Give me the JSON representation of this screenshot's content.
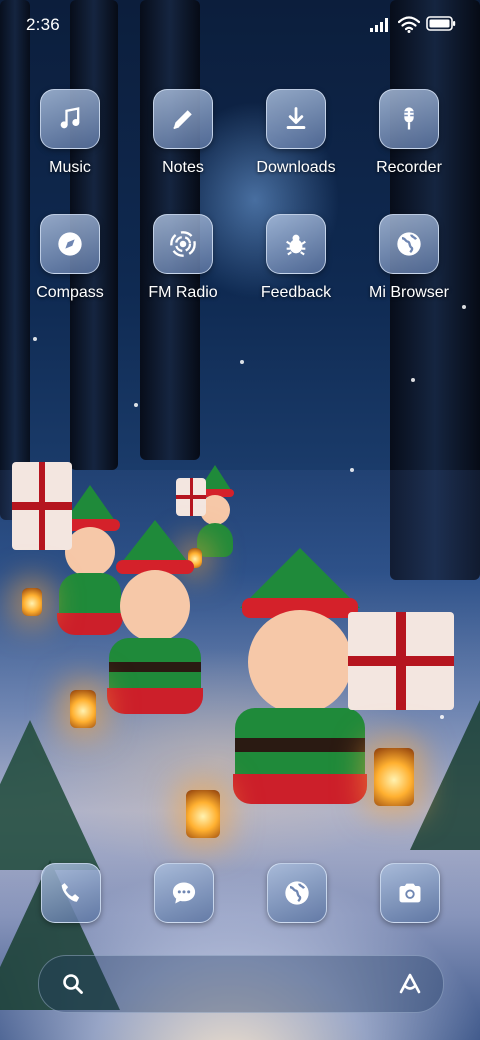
{
  "status_bar": {
    "time": "2:36",
    "signal_icon": "cellular-signal-icon",
    "wifi_icon": "wifi-icon",
    "battery_icon": "battery-full-icon"
  },
  "apps": [
    {
      "label": "Music",
      "icon": "music-note-icon"
    },
    {
      "label": "Notes",
      "icon": "pencil-icon"
    },
    {
      "label": "Downloads",
      "icon": "download-icon"
    },
    {
      "label": "Recorder",
      "icon": "microphone-icon"
    },
    {
      "label": "Compass",
      "icon": "compass-icon"
    },
    {
      "label": "FM Radio",
      "icon": "radio-waves-icon"
    },
    {
      "label": "Feedback",
      "icon": "bug-icon"
    },
    {
      "label": "Mi Browser",
      "icon": "globe-icon"
    }
  ],
  "dock": [
    {
      "icon": "phone-icon"
    },
    {
      "icon": "chat-bubble-icon"
    },
    {
      "icon": "globe-icon"
    },
    {
      "icon": "camera-icon"
    }
  ],
  "search_bar": {
    "search_icon": "search-icon",
    "assistant_icon": "assistant-icon"
  },
  "wallpaper": {
    "theme": "christmas-elves-forest",
    "colors": {
      "sky": "#0f2a52",
      "hat_green": "#1f8a3a",
      "hat_red": "#d4212a",
      "lantern": "#ffb030"
    }
  }
}
